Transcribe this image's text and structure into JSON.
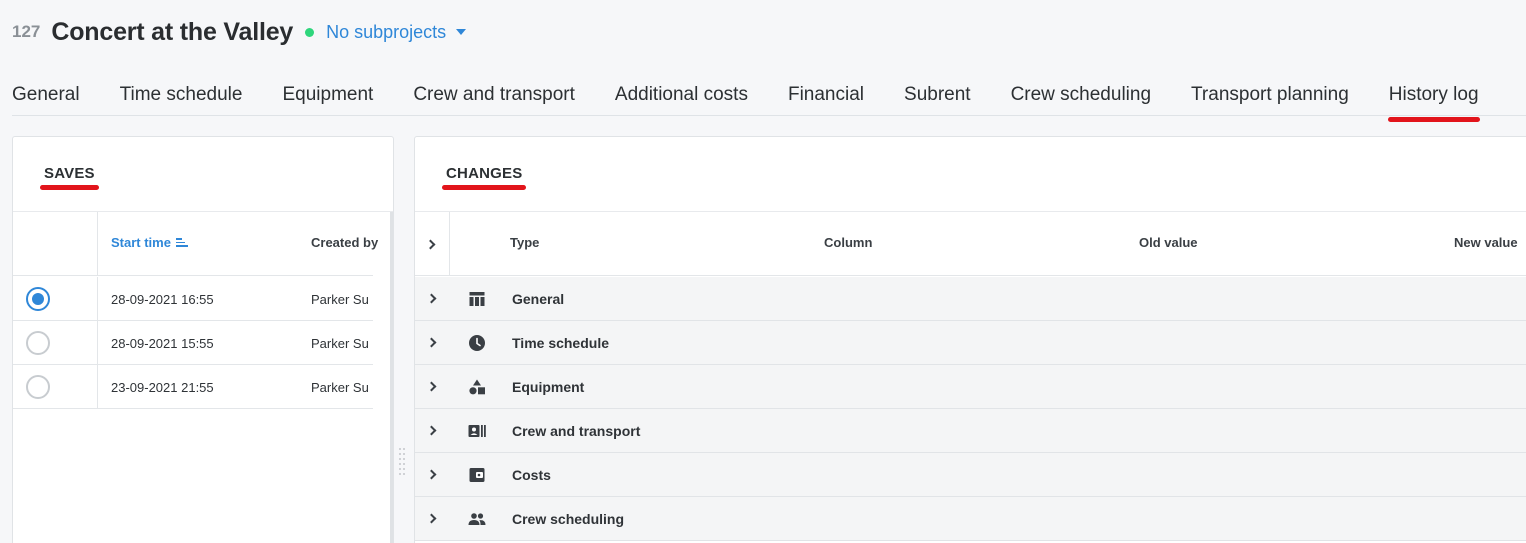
{
  "header": {
    "project_id": "127",
    "project_title": "Concert at the Valley",
    "status_color": "#2ed67c",
    "subprojects_label": "No subprojects"
  },
  "tabs": [
    {
      "label": "General"
    },
    {
      "label": "Time schedule"
    },
    {
      "label": "Equipment"
    },
    {
      "label": "Crew and transport"
    },
    {
      "label": "Additional costs"
    },
    {
      "label": "Financial"
    },
    {
      "label": "Subrent"
    },
    {
      "label": "Crew scheduling"
    },
    {
      "label": "Transport planning"
    },
    {
      "label": "History log",
      "active": true
    }
  ],
  "saves": {
    "title": "SAVES",
    "columns": {
      "start_time": "Start time",
      "created_by": "Created by"
    },
    "rows": [
      {
        "start_time": "28-09-2021 16:55",
        "created_by": "Parker Su",
        "selected": true
      },
      {
        "start_time": "28-09-2021 15:55",
        "created_by": "Parker Su",
        "selected": false
      },
      {
        "start_time": "23-09-2021 21:55",
        "created_by": "Parker Su",
        "selected": false
      }
    ]
  },
  "changes": {
    "title": "CHANGES",
    "columns": {
      "type": "Type",
      "column": "Column",
      "old_value": "Old value",
      "new_value": "New value"
    },
    "groups": [
      {
        "label": "General",
        "icon": "table-icon"
      },
      {
        "label": "Time schedule",
        "icon": "clock-icon"
      },
      {
        "label": "Equipment",
        "icon": "shapes-icon"
      },
      {
        "label": "Crew and transport",
        "icon": "id-card-icon"
      },
      {
        "label": "Costs",
        "icon": "wallet-icon"
      },
      {
        "label": "Crew scheduling",
        "icon": "people-icon"
      }
    ]
  },
  "colors": {
    "accent": "#2f87d8",
    "highlight": "#e2141b"
  }
}
